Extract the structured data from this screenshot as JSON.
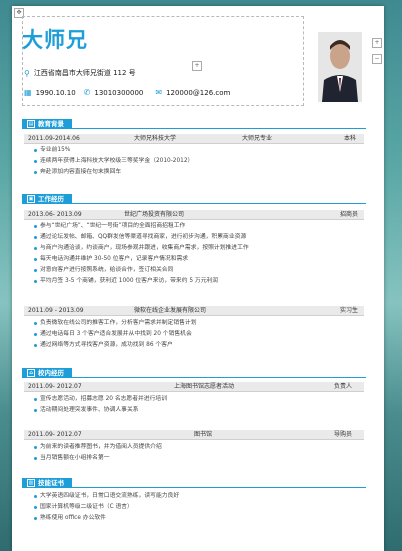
{
  "header": {
    "name": "大师兄",
    "address": "江西省南昌市大师兄街道 112 号",
    "birth": "1990.10.10",
    "phone": "13010300000",
    "email": "120000@126.com"
  },
  "controls": {
    "move": "✥",
    "plus": "+",
    "minus": "−"
  },
  "sections": {
    "education": "教育背景",
    "work": "工作经历",
    "campus": "校内经历",
    "skills": "技能证书"
  },
  "education": {
    "period": "2011.09-2014.06",
    "school": "大师兄科技大学",
    "major": "大师兄专业",
    "degree": "本科",
    "items": [
      "专业前15%",
      "连续两年获得上海科技大学校级三等奖学金（2010-2012）",
      "奔赴添加内容直接在句末换回车"
    ]
  },
  "work": [
    {
      "period": "2013.06- 2013.09",
      "company": "世纪广场投资有限公司",
      "role": "招商员",
      "items": [
        "参与“世纪广场”、“世纪一号街”项目的全面招商招租工作",
        "通过论坛发帖、邮箱、QQ群发信等渠道寻找商家，进行初步沟通，积累商业资源",
        "与商户沟通洽谈，约谈商户，现场参观并跟进，收集商户需求，按照计划推进工作",
        "每天电话沟通并维护 30-50 位客户，记录客户情况和需求",
        "对意向客户进行按照系统，给谈合作，签订相关合同",
        "平均月签 3-5 个商铺，获利近 1000 位客户来访，带来约 5 万元利润"
      ]
    },
    {
      "period": "2011.09 - 2013.09",
      "company": "微软在线企业发展有限公司",
      "role": "实习生",
      "items": [
        "负责微软在线公司的推客工作，分析客户需求并制定销售计划",
        "通过电话每日 3 个客户适合发展并从中找到 20 个销售机会",
        "通过网络等方式寻找客户资源，成功找到 86 个客户"
      ]
    }
  ],
  "campus": [
    {
      "period": "2011.09- 2012.07",
      "org": "上海图书馆志愿者活动",
      "role": "负责人",
      "items": [
        "宣传志愿活动，招募志愿 20 名志愿者并进行培训",
        "活动期间处理突发事件、协调人事关系"
      ]
    },
    {
      "period": "2011.09- 2012.07",
      "org": "图书馆",
      "role": "导购员",
      "items": [
        "为前来的读者推荐图书，并为借阅人员提供介绍",
        "当月销售额在小组排名第一"
      ]
    }
  ],
  "skills": {
    "items": [
      "大学英语四级证书，日常口语交流熟练，读写能力良好",
      "国家计算机等级二级证书（C 语言）",
      "熟练使用 office 办公软件"
    ]
  },
  "colors": {
    "accent": "#1e9ed9"
  }
}
